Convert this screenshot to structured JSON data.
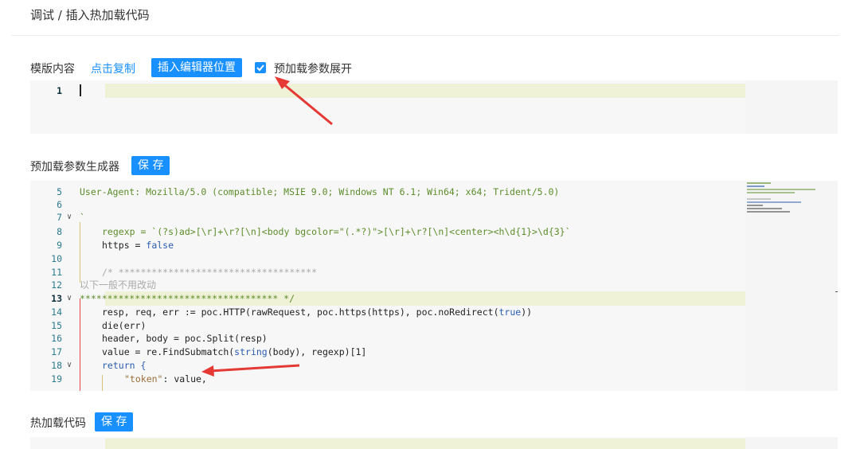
{
  "breadcrumb": "调试 / 插入热加载代码",
  "template_section": {
    "label": "模版内容",
    "copy_link": "点击复制",
    "insert_button": "插入编辑器位置",
    "checkbox_label": "预加载参数展开",
    "checkbox_checked": true,
    "editor_lines": [
      "1"
    ]
  },
  "generator_section": {
    "label": "预加载参数生成器",
    "save_button": "保 存",
    "lines": [
      {
        "n": "5",
        "text": "User-Agent: Mozilla/5.0 (compatible; MSIE 9.0; Windows NT 6.1; Win64; x64; Trident/5.0)"
      },
      {
        "n": "6",
        "text": ""
      },
      {
        "n": "7",
        "text": "`"
      },
      {
        "n": "8",
        "text": "regexp = `(?s)ad>[\\r]+\\r?[\\n]<body bgcolor=\"(.*?)\">[\\r]+\\r?[\\n]<center><h\\d{1}>\\d{3}`"
      },
      {
        "n": "9",
        "text_a": "https = ",
        "text_b": "false"
      },
      {
        "n": "10",
        "text": ""
      },
      {
        "n": "11",
        "text": "/* ************************************"
      },
      {
        "n": "12",
        "text": "以下一般不用改动"
      },
      {
        "n": "13",
        "text": "************************************ */"
      },
      {
        "n": "14",
        "text_a": "resp, req, err := poc.HTTP(rawRequest, poc.https(https), poc.noRedirect(",
        "text_b": "true",
        "text_c": "))"
      },
      {
        "n": "15",
        "text": "die(err)"
      },
      {
        "n": "16",
        "text": "header, body = poc.Split(resp)"
      },
      {
        "n": "17",
        "text_a": "value = re.FindSubmatch(",
        "text_b": "string",
        "text_c": "(body), regexp)[1]"
      },
      {
        "n": "18",
        "text": "return {"
      },
      {
        "n": "19",
        "text_a": "\"token\"",
        "text_b": ": value,"
      }
    ]
  },
  "hotload_section": {
    "label": "热加载代码",
    "save_button": "保 存"
  }
}
